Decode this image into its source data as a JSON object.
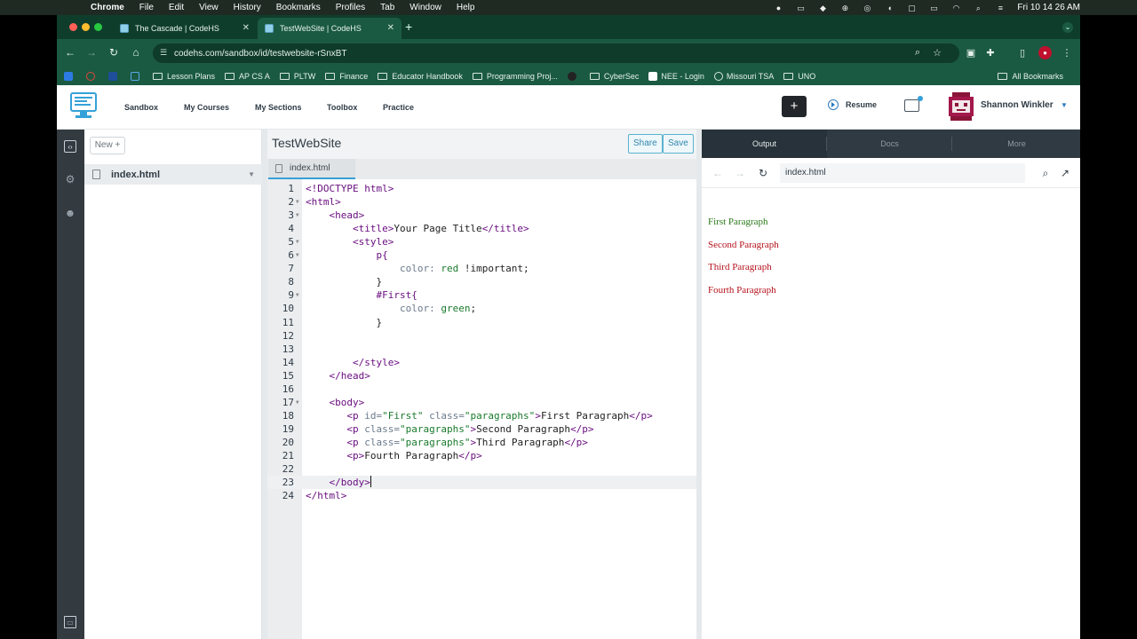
{
  "menubar": {
    "app": "Chrome",
    "items": [
      "File",
      "Edit",
      "View",
      "History",
      "Bookmarks",
      "Profiles",
      "Tab",
      "Window",
      "Help"
    ],
    "clock": "Fri 10 14 26 AM"
  },
  "tabs": [
    {
      "title": "The Cascade | CodeHS",
      "active": false
    },
    {
      "title": "TestWebSite | CodeHS",
      "active": true
    }
  ],
  "url": "codehs.com/sandbox/id/testwebsite-rSnxBT",
  "bookmarks": [
    {
      "label": "Lesson Plans",
      "icon": "folder"
    },
    {
      "label": "AP CS A",
      "icon": "folder"
    },
    {
      "label": "PLTW",
      "icon": "folder"
    },
    {
      "label": "Finance",
      "icon": "folder"
    },
    {
      "label": "Educator Handbook",
      "icon": "folder"
    },
    {
      "label": "Programming Proj...",
      "icon": "folder"
    },
    {
      "label": "CyberSec",
      "icon": "folder"
    },
    {
      "label": "NEE - Login",
      "icon": "page"
    },
    {
      "label": "Missouri TSA",
      "icon": "globe"
    },
    {
      "label": "UNO",
      "icon": "folder"
    }
  ],
  "all_bookmarks": "All Bookmarks",
  "nav": {
    "links": [
      "Sandbox",
      "My Courses",
      "My Sections",
      "Toolbox",
      "Practice"
    ],
    "plus": "+",
    "resume": "Resume",
    "username": "Shannon Winkler"
  },
  "filepanel": {
    "new_label": "New +",
    "file": "index.html"
  },
  "editor": {
    "project_title": "TestWebSite",
    "share_label": "Share",
    "save_label": "Save",
    "tab_file": "index.html",
    "highlight_line": 23
  },
  "code_lines": [
    {
      "n": "1",
      "fold": false,
      "parts": [
        [
          "tag",
          "<!DOCTYPE html>"
        ]
      ]
    },
    {
      "n": "2",
      "fold": true,
      "parts": [
        [
          "tag",
          "<html>"
        ]
      ]
    },
    {
      "n": "3",
      "fold": true,
      "parts": [
        [
          "txt",
          "    "
        ],
        [
          "tag",
          "<head>"
        ]
      ]
    },
    {
      "n": "4",
      "fold": false,
      "parts": [
        [
          "txt",
          "        "
        ],
        [
          "tag",
          "<title>"
        ],
        [
          "txt",
          "Your Page Title"
        ],
        [
          "tag",
          "</title>"
        ]
      ]
    },
    {
      "n": "5",
      "fold": true,
      "parts": [
        [
          "txt",
          "        "
        ],
        [
          "tag",
          "<style>"
        ]
      ]
    },
    {
      "n": "6",
      "fold": true,
      "parts": [
        [
          "txt",
          "            "
        ],
        [
          "tag",
          "p{"
        ]
      ]
    },
    {
      "n": "7",
      "fold": false,
      "parts": [
        [
          "txt",
          "                "
        ],
        [
          "attr",
          "color: "
        ],
        [
          "str",
          "red"
        ],
        [
          "txt",
          " !important;"
        ]
      ]
    },
    {
      "n": "8",
      "fold": false,
      "parts": [
        [
          "txt",
          "            "
        ],
        [
          "txt",
          "}"
        ]
      ]
    },
    {
      "n": "9",
      "fold": true,
      "parts": [
        [
          "txt",
          "            "
        ],
        [
          "tag",
          "#First{"
        ]
      ]
    },
    {
      "n": "10",
      "fold": false,
      "parts": [
        [
          "txt",
          "                "
        ],
        [
          "attr",
          "color: "
        ],
        [
          "str",
          "green"
        ],
        [
          "txt",
          ";"
        ]
      ]
    },
    {
      "n": "11",
      "fold": false,
      "parts": [
        [
          "txt",
          "            "
        ],
        [
          "txt",
          "}"
        ]
      ]
    },
    {
      "n": "12",
      "fold": false,
      "parts": []
    },
    {
      "n": "13",
      "fold": false,
      "parts": []
    },
    {
      "n": "14",
      "fold": false,
      "parts": [
        [
          "txt",
          "        "
        ],
        [
          "tag",
          "</style>"
        ]
      ]
    },
    {
      "n": "15",
      "fold": false,
      "parts": [
        [
          "txt",
          "    "
        ],
        [
          "tag",
          "</head>"
        ]
      ]
    },
    {
      "n": "16",
      "fold": false,
      "parts": []
    },
    {
      "n": "17",
      "fold": true,
      "parts": [
        [
          "txt",
          "    "
        ],
        [
          "tag",
          "<body>"
        ]
      ]
    },
    {
      "n": "18",
      "fold": false,
      "parts": [
        [
          "txt",
          "       "
        ],
        [
          "tag",
          "<p "
        ],
        [
          "attr",
          "id="
        ],
        [
          "str",
          "\"First\""
        ],
        [
          "attr",
          " class="
        ],
        [
          "str",
          "\"paragraphs\""
        ],
        [
          "tag",
          ">"
        ],
        [
          "txt",
          "First Paragraph"
        ],
        [
          "tag",
          "</p>"
        ]
      ]
    },
    {
      "n": "19",
      "fold": false,
      "parts": [
        [
          "txt",
          "       "
        ],
        [
          "tag",
          "<p "
        ],
        [
          "attr",
          "class="
        ],
        [
          "str",
          "\"paragraphs\""
        ],
        [
          "tag",
          ">"
        ],
        [
          "txt",
          "Second Paragraph"
        ],
        [
          "tag",
          "</p>"
        ]
      ]
    },
    {
      "n": "20",
      "fold": false,
      "parts": [
        [
          "txt",
          "       "
        ],
        [
          "tag",
          "<p "
        ],
        [
          "attr",
          "class="
        ],
        [
          "str",
          "\"paragraphs\""
        ],
        [
          "tag",
          ">"
        ],
        [
          "txt",
          "Third Paragraph"
        ],
        [
          "tag",
          "</p>"
        ]
      ]
    },
    {
      "n": "21",
      "fold": false,
      "parts": [
        [
          "txt",
          "       "
        ],
        [
          "tag",
          "<p>"
        ],
        [
          "txt",
          "Fourth Paragraph"
        ],
        [
          "tag",
          "</p>"
        ]
      ]
    },
    {
      "n": "22",
      "fold": false,
      "parts": []
    },
    {
      "n": "23",
      "fold": false,
      "parts": [
        [
          "txt",
          "    "
        ],
        [
          "tag",
          "</body>"
        ]
      ]
    },
    {
      "n": "24",
      "fold": false,
      "parts": [
        [
          "tag",
          "</html>"
        ]
      ]
    }
  ],
  "output": {
    "tabs": [
      "Output",
      "Docs",
      "More"
    ],
    "url": "index.html",
    "paragraphs": [
      {
        "text": "First Paragraph",
        "color": "#2a7a1a"
      },
      {
        "text": "Second Paragraph",
        "color": "#b5121b"
      },
      {
        "text": "Third Paragraph",
        "color": "#b5121b"
      },
      {
        "text": "Fourth Paragraph",
        "color": "#b5121b"
      }
    ]
  },
  "colors": {
    "chrome_frame": "#1b5a42",
    "accent": "#35a1d8",
    "rail": "#333a40"
  }
}
